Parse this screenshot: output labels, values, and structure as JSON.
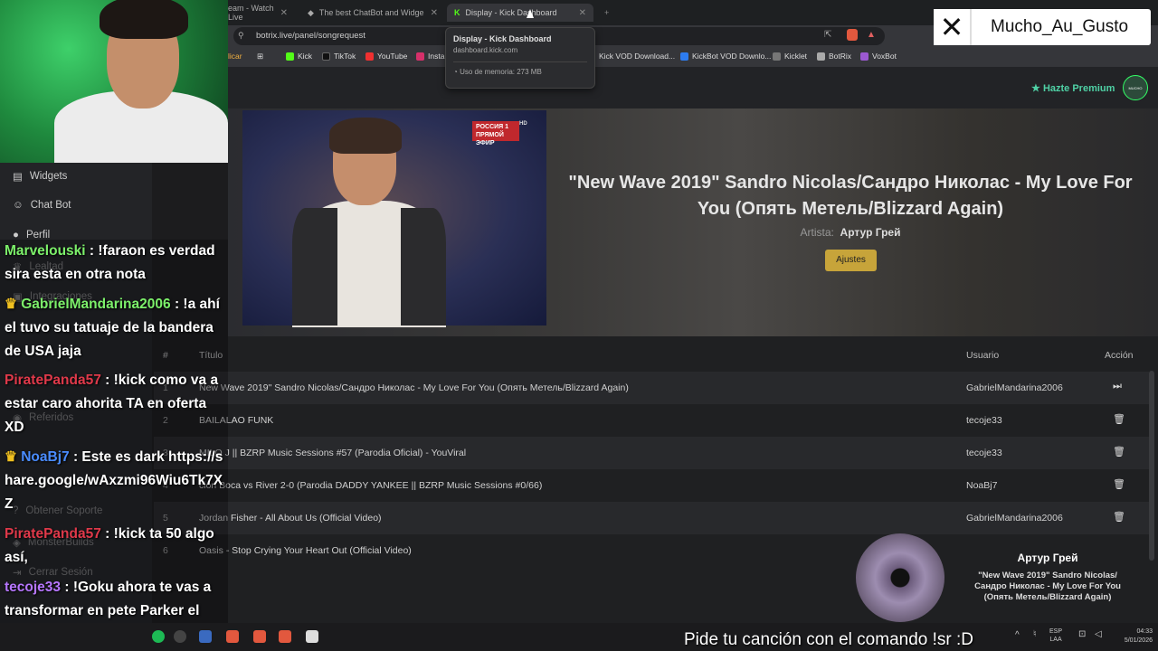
{
  "browser": {
    "tabs": [
      {
        "label": "eam - Watch Live",
        "active": false
      },
      {
        "label": "The best ChatBot and Widge",
        "active": false
      },
      {
        "label": "Display - Kick Dashboard",
        "active": true
      }
    ],
    "url": "botrix.live/panel/songrequest",
    "bookmarks": [
      "licar",
      "Kick",
      "TikTok",
      "YouTube",
      "Insta",
      "Kick VOD Download...",
      "KickBot VOD Downlo...",
      "Kicklet",
      "BotRix",
      "VoxBot"
    ],
    "tooltip": {
      "title": "Display - Kick Dashboard",
      "domain": "dashboard.kick.com",
      "memory": "Uso de memoria: 273 MB"
    }
  },
  "header": {
    "premium": "Hazte Premium",
    "avatar_text": "MUCHO GUSTO"
  },
  "hero": {
    "badge_line1": "РОССИЯ 1",
    "badge_line2": "ПРЯМОЙ ЭФИР",
    "badge_hd": "HD",
    "title": "\"New Wave 2019\" Sandro Nicolas/Сандро Николас - My Love For You (Опять Метель/Blizzard Again)",
    "artist_label": "Artista:",
    "artist": "Артур Грей",
    "settings_button": "Ajustes"
  },
  "table": {
    "headers": {
      "num": "#",
      "title": "Título",
      "user": "Usuario",
      "action": "Acción"
    },
    "rows": [
      {
        "num": "1",
        "title": "New Wave 2019\" Sandro Nicolas/Сандро Николас - My Love For You (Опять Метель/Blizzard Again)",
        "user": "GabrielMandarina2006"
      },
      {
        "num": "2",
        "title": "BAILALAO FUNK",
        "user": "tecoje33"
      },
      {
        "num": "3",
        "title": "MILO J || BZRP Music Sessions #57 (Parodia Oficial) - YouViral",
        "user": "tecoje33"
      },
      {
        "num": "4",
        "title": "ción Boca vs River 2-0 (Parodia DADDY YANKEE || BZRP Music Sessions #0/66)",
        "user": "NoaBj7"
      },
      {
        "num": "5",
        "title": "Jordan Fisher - All About Us (Official Video)",
        "user": "GabrielMandarina2006"
      },
      {
        "num": "6",
        "title": "Oasis - Stop Crying Your Heart Out (Official Video)",
        "user": ""
      }
    ]
  },
  "sidebar": {
    "items": [
      {
        "label": "Widgets",
        "icon": "widgets-icon"
      },
      {
        "label": "Chat Bot",
        "icon": "robot-icon"
      },
      {
        "label": "Perfil",
        "icon": "user-icon"
      },
      {
        "label": "Lealtad",
        "icon": "trophy-icon"
      },
      {
        "label": "Integraciones",
        "icon": "plug-icon"
      },
      {
        "label": "Referidos",
        "icon": "users-icon"
      },
      {
        "label": "Obtener Soporte",
        "icon": "support-icon"
      },
      {
        "label": "MonsterBuilds",
        "icon": "build-icon"
      },
      {
        "label": "Cerrar Sesión",
        "icon": "logout-icon"
      }
    ]
  },
  "chat": [
    {
      "user": "Marvelouski",
      "color": "#7cf06a",
      "badge": false,
      "msg": ": !faraon es verdad sira esta en otra nota"
    },
    {
      "user": "GabrielMandarina2006",
      "color": "#7cf06a",
      "badge": true,
      "msg": ": !a ahí el tuvo su tatuaje de la bandera de USA jaja"
    },
    {
      "user": "PiratePanda57",
      "color": "#e0394a",
      "badge": false,
      "msg": ": !kick como va a estar caro ahorita TA en oferta XD"
    },
    {
      "user": "NoaBj7",
      "color": "#4a8cff",
      "badge": true,
      "msg": ": Este es dark https://share.google/wAxzmi96Wiu6Tk7XZ"
    },
    {
      "user": "PiratePanda57",
      "color": "#e0394a",
      "badge": false,
      "msg": ": !kick ta 50 algo así,"
    },
    {
      "user": "tecoje33",
      "color": "#b676ff",
      "badge": false,
      "msg": ": !Goku ahora te vas a transformar en pete Parker el hombre que araña"
    }
  ],
  "xbadge": {
    "handle": "Mucho_Au_Gusto"
  },
  "now_playing": {
    "artist": "Артур Грей",
    "title": "\"New Wave 2019\" Sandro Nicolas/ Сандро Николас - My Love For You (Опять Метель/Blizzard Again)"
  },
  "overlay": {
    "command_text": "Pide tu canción con el comando !sr :D"
  },
  "taskbar": {
    "lang_top": "ESP",
    "lang_bottom": "LAA",
    "time": "04:33",
    "date": "5/01/2026"
  },
  "colors": {
    "accent": "#c7a43a",
    "premium": "#4fd1a5"
  }
}
